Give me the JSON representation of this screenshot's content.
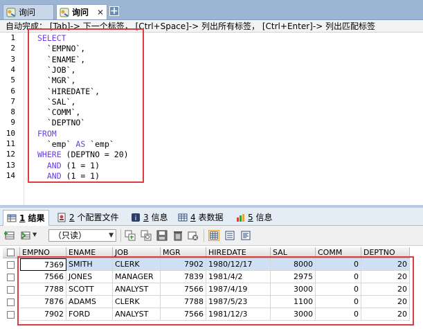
{
  "tabs": [
    {
      "label": "询问",
      "active": false
    },
    {
      "label": "询问",
      "active": true,
      "close": "✕"
    }
  ],
  "add_tab": "+",
  "hint": "自动完成： [Tab]-> 下一个标签， [Ctrl+Space]-> 列出所有标签， [Ctrl+Enter]-> 列出匹配标签",
  "editor": {
    "lines": [
      {
        "n": "1",
        "parts": [
          {
            "t": "SELECT",
            "kw": true
          }
        ]
      },
      {
        "n": "2",
        "parts": [
          {
            "t": "  `EMPNO`,",
            "kw": false
          }
        ]
      },
      {
        "n": "3",
        "parts": [
          {
            "t": "  `ENAME`,",
            "kw": false
          }
        ]
      },
      {
        "n": "4",
        "parts": [
          {
            "t": "  `JOB`,",
            "kw": false
          }
        ]
      },
      {
        "n": "5",
        "parts": [
          {
            "t": "  `MGR`,",
            "kw": false
          }
        ]
      },
      {
        "n": "6",
        "parts": [
          {
            "t": "  `HIREDATE`,",
            "kw": false
          }
        ]
      },
      {
        "n": "7",
        "parts": [
          {
            "t": "  `SAL`,",
            "kw": false
          }
        ]
      },
      {
        "n": "8",
        "parts": [
          {
            "t": "  `COMM`,",
            "kw": false
          }
        ]
      },
      {
        "n": "9",
        "parts": [
          {
            "t": "  `DEPTNO`",
            "kw": false
          }
        ]
      },
      {
        "n": "10",
        "parts": [
          {
            "t": "FROM",
            "kw": true
          }
        ]
      },
      {
        "n": "11",
        "parts": [
          {
            "t": "  `emp` ",
            "kw": false
          },
          {
            "t": "AS",
            "kw": true
          },
          {
            "t": " `emp`",
            "kw": false
          }
        ]
      },
      {
        "n": "12",
        "parts": [
          {
            "t": "WHERE",
            "kw": true
          },
          {
            "t": " (DEPTNO = 20)",
            "kw": false
          }
        ]
      },
      {
        "n": "13",
        "parts": [
          {
            "t": "  ",
            "kw": false
          },
          {
            "t": "AND",
            "kw": true
          },
          {
            "t": " (1 = 1)",
            "kw": false
          }
        ]
      },
      {
        "n": "14",
        "parts": [
          {
            "t": "  ",
            "kw": false
          },
          {
            "t": "AND",
            "kw": true
          },
          {
            "t": " (1 = 1)",
            "kw": false
          }
        ]
      }
    ]
  },
  "lower_tabs": [
    {
      "num": "1",
      "label": "结果",
      "active": true,
      "icon": "table-result-icon"
    },
    {
      "num": "2",
      "label": "个配置文件",
      "active": false,
      "icon": "profile-icon"
    },
    {
      "num": "3",
      "label": "信息",
      "active": false,
      "icon": "info-icon"
    },
    {
      "num": "4",
      "label": "表数据",
      "active": false,
      "icon": "table-data-icon"
    },
    {
      "num": "5",
      "label": "信息",
      "active": false,
      "icon": "info-chart-icon"
    }
  ],
  "toolbar": {
    "readonly_select": "（只读）"
  },
  "grid": {
    "columns": [
      "EMPNO",
      "ENAME",
      "JOB",
      "MGR",
      "HIREDATE",
      "SAL",
      "COMM",
      "DEPTNO"
    ],
    "rows": [
      [
        "7369",
        "SMITH",
        "CLERK",
        "7902",
        "1980/12/17",
        "8000",
        "0",
        "20"
      ],
      [
        "7566",
        "JONES",
        "MANAGER",
        "7839",
        "1981/4/2",
        "2975",
        "0",
        "20"
      ],
      [
        "7788",
        "SCOTT",
        "ANALYST",
        "7566",
        "1987/4/19",
        "3000",
        "0",
        "20"
      ],
      [
        "7876",
        "ADAMS",
        "CLERK",
        "7788",
        "1987/5/23",
        "1100",
        "0",
        "20"
      ],
      [
        "7902",
        "FORD",
        "ANALYST",
        "7566",
        "1981/12/3",
        "3000",
        "0",
        "20"
      ]
    ]
  },
  "colors": {
    "keyword": "#6a3de8",
    "highlight_box": "#e0393e",
    "selected_row": "#cfe0f5",
    "tab_bar": "#9cb5d3"
  }
}
